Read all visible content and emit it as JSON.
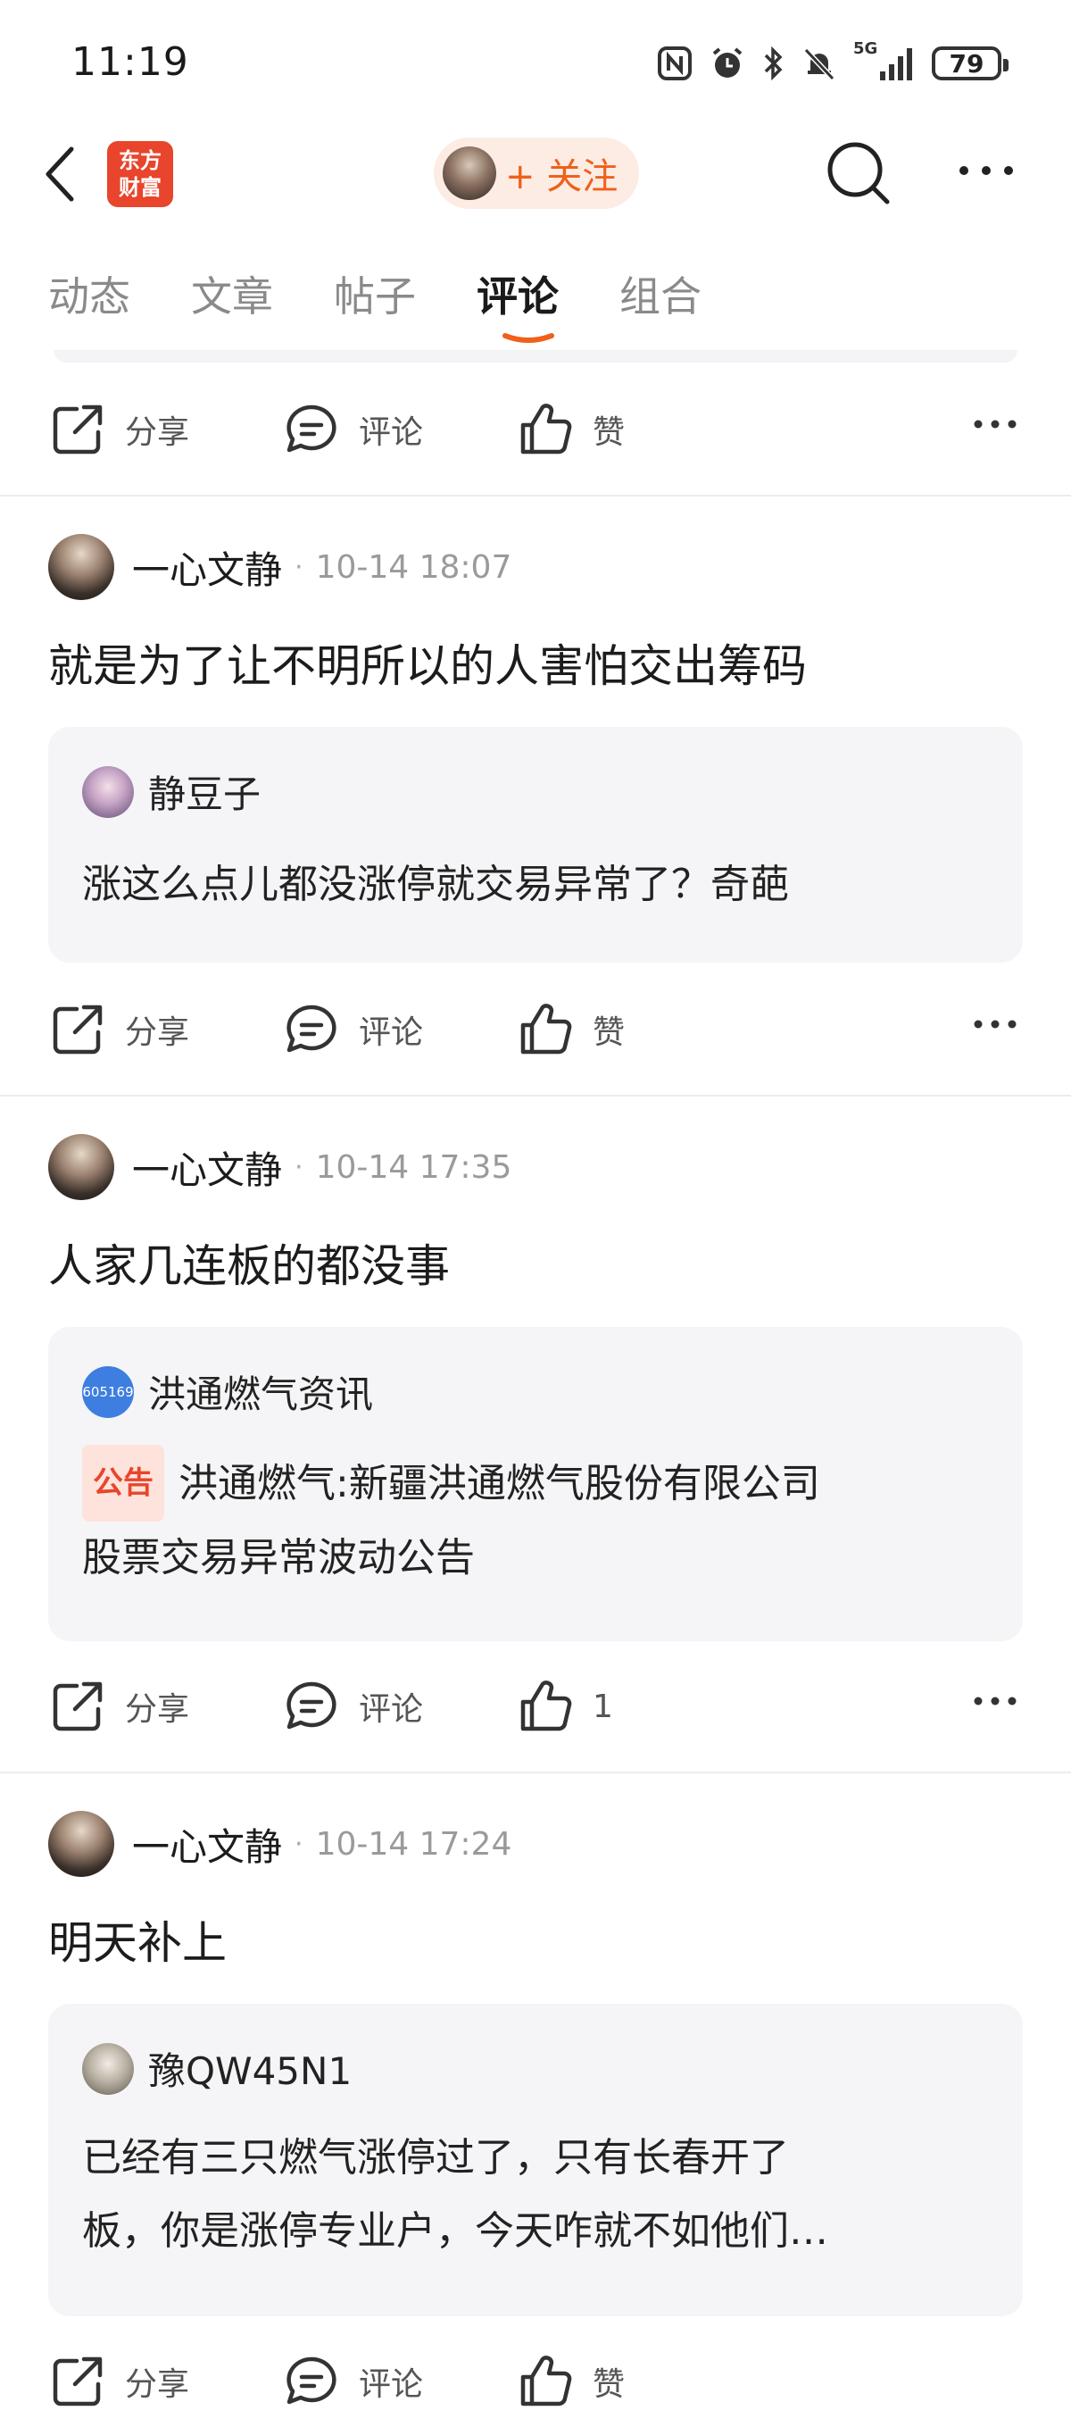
{
  "status_bar": {
    "time": "11:19",
    "battery": "79",
    "network": "5G"
  },
  "header": {
    "logo_line1": "东方",
    "logo_line2": "财富",
    "follow_label": "+ 关注"
  },
  "tabs": [
    {
      "label": "动态"
    },
    {
      "label": "文章"
    },
    {
      "label": "帖子"
    },
    {
      "label": "评论",
      "active": true
    },
    {
      "label": "组合"
    }
  ],
  "actions": {
    "share": "分享",
    "comment": "评论",
    "like": "赞"
  },
  "posts": [
    {
      "author": "一心文静",
      "time": "10-14 18:07",
      "body": "就是为了让不明所以的人害怕交出筹码",
      "quote_author": "静豆子",
      "quote_text": "涨这么点儿都没涨停就交易异常了？奇葩",
      "like_label": "赞"
    },
    {
      "author": "一心文静",
      "time": "10-14 17:35",
      "body": "人家几连板的都没事",
      "quote_author": "洪通燃气资讯",
      "quote_avatar_text": "605169",
      "quote_badge": "公告",
      "quote_text_line1": "洪通燃气:新疆洪通燃气股份有限公司",
      "quote_text_line2": "股票交易异常波动公告",
      "like_label": "1"
    },
    {
      "author": "一心文静",
      "time": "10-14 17:24",
      "body": "明天补上",
      "quote_author": "豫QW45N1",
      "quote_text_line1": "已经有三只燃气涨停过了，只有长春开了",
      "quote_text_line2": "板，你是涨停专业户，今天咋就不如他们…",
      "like_label": "赞"
    }
  ]
}
